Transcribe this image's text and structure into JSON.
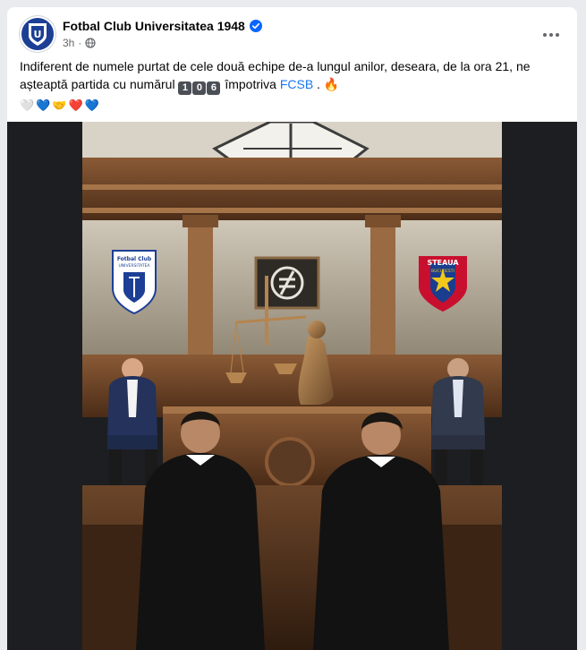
{
  "post": {
    "page_name": "Fotbal Club Universitatea 1948",
    "time": "3h",
    "privacy_icon": "globe-icon",
    "text_before": "Indiferent de numele purtat de cele două echipe de-a lungul anilor, deseara, de la ora 21, ne așteaptă partida cu numărul ",
    "number_keycaps": [
      "1",
      "0",
      "6"
    ],
    "text_middle": " împotriva ",
    "mention": "FCSB",
    "text_after": " . ",
    "fire_emoji": "🔥",
    "emoji_line": [
      "🤍",
      "💙",
      "🤝",
      "❤️",
      "💙"
    ]
  },
  "image": {
    "crest_left_text": "Fotbal Club",
    "crest_left_sub": "UNIVERSITATEA",
    "crest_right_text": "STEAUA",
    "crest_right_sub": "BUCURESTI"
  },
  "colors": {
    "link": "#1877f2",
    "meta": "#65676b",
    "verified": "#0866ff",
    "u_blue": "#1c3f95",
    "steaua_red": "#c8102e",
    "steaua_blue": "#1b3d8f"
  }
}
